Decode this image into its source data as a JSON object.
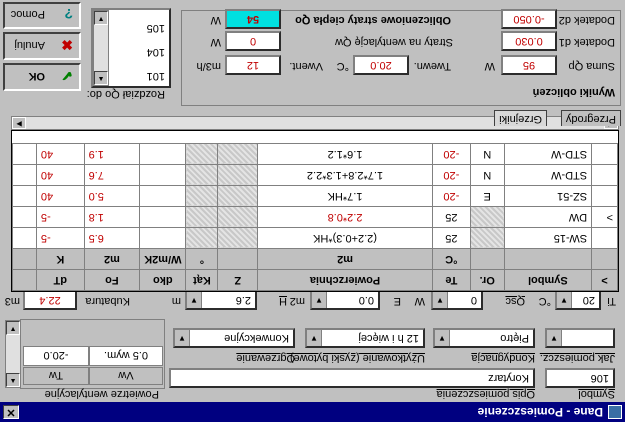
{
  "title": "Dane - Pomieszczenie",
  "general": {
    "symbol_label": "Symbol",
    "symbol_value": "106",
    "description_label": "Opis pomieszczenia",
    "description_value": "Korytarz",
    "room_type_label": "Jak pomieszcz.",
    "room_type_value": "",
    "floor_label": "Kondygnacja",
    "floor_value": "Piętro",
    "usage_label": "Użytkowanie (zyski bytowe)",
    "usage_value": "12 h i więcej",
    "heating_label": "Ogrzewanie",
    "heating_value": "Konwekcyjne"
  },
  "ventilation": {
    "group_label": "Powietrze wentylacyjne",
    "col1_header": "Vw",
    "col2_header": "Tw",
    "col1_value": "0.5 wym.",
    "col2_value": "-20.0"
  },
  "params": {
    "ti_label": "Ti",
    "ti_value": "20",
    "ti_unit": "°C",
    "qsc_label": "Qsc",
    "qsc_value": "0",
    "qsc_unit": "W",
    "e_label": "E",
    "e_value": "0.0",
    "e_unit": "m2",
    "h_label": "H",
    "h_value": "2.6",
    "h_unit": "m",
    "kubatura_label": "Kubatura",
    "kubatura_value": "22.4",
    "kubatura_unit": "m3"
  },
  "table": {
    "headers_top": [
      ">",
      "Symbol",
      "Or.",
      "Te",
      "Powierzchnia",
      "Z",
      "Kąt",
      "dko",
      "Fo",
      "dT"
    ],
    "headers_bottom": [
      "",
      "",
      "",
      "°C",
      "m2",
      "",
      "°",
      "W/m2K",
      "m2",
      "K"
    ],
    "rows": [
      {
        "marker": "",
        "symbol": "SW-15",
        "or": "",
        "te": "25",
        "area": "(2.2+0.3)*HK",
        "z": "",
        "kat": "",
        "dko": "",
        "fo": "6.5",
        "dt": "-5"
      },
      {
        "marker": ">",
        "symbol": "DW",
        "or": "",
        "te": "25",
        "area": "2.2*0.8",
        "z": "",
        "kat": "",
        "dko": "",
        "fo": "1.8",
        "dt": "-5"
      },
      {
        "marker": "",
        "symbol": "SZ-51",
        "or": "E",
        "te": "-20",
        "area": "1.7*HK",
        "z": "",
        "kat": "",
        "dko": "",
        "fo": "5.0",
        "dt": "40"
      },
      {
        "marker": "",
        "symbol": "STD-W",
        "or": "N",
        "te": "-20",
        "area": "1.7*2.8+1.3*2.2",
        "z": "",
        "kat": "",
        "dko": "",
        "fo": "7.6",
        "dt": "40"
      },
      {
        "marker": "",
        "symbol": "STD-W",
        "or": "N",
        "te": "-20",
        "area": "1.6*1.2",
        "z": "",
        "kat": "",
        "dko": "",
        "fo": "1.9",
        "dt": "40"
      }
    ]
  },
  "tabs": [
    "Przegrody",
    "Grzejniki"
  ],
  "results": {
    "group_label": "Wyniki obliczeń",
    "sum_label": "Suma Qp",
    "sum_value": "95",
    "sum_unit": "W",
    "twewn_label": "Twewn.",
    "twewn_value": "20.0",
    "twewn_unit": "°C",
    "vwent_label": "Vwent.",
    "vwent_value": "12",
    "vwent_unit": "m3/h",
    "d1_label": "Dodatek d1",
    "d1_value": "0.030",
    "d2_label": "Dodatek d2",
    "d2_value": "-0.050",
    "loss_vent_label": "Straty na wentylację Qw",
    "loss_vent_value": "0",
    "loss_vent_unit": "W",
    "calc_loss_label": "Obliczeniowe straty ciepła Qo",
    "calc_loss_value": "54",
    "calc_loss_unit": "W"
  },
  "heater_list": {
    "label": "Rozdział Qo do:",
    "items": [
      "101",
      "104",
      "105"
    ]
  },
  "buttons": {
    "ok": "OK",
    "cancel": "Anuluj",
    "help": "Pomoc"
  }
}
